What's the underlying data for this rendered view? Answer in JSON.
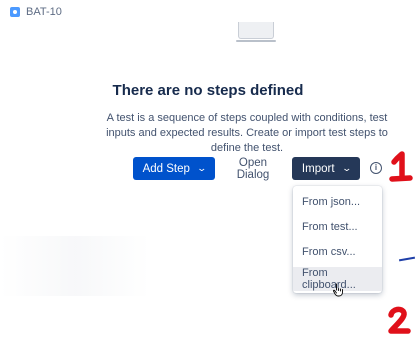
{
  "issue": {
    "key": "BAT-10",
    "icon": "issue-type-icon"
  },
  "empty_state": {
    "title": "There are no steps defined",
    "description": "A test is a sequence of steps coupled with conditions, test inputs and expected results. Create or import test steps to define the test."
  },
  "actions": {
    "add_step": "Add Step",
    "open_dialog": "Open Dialog",
    "import": "Import",
    "info_icon": "info-icon"
  },
  "import_menu": {
    "items": [
      "From json...",
      "From test...",
      "From csv...",
      "From clipboard..."
    ],
    "hovered_index": 3
  },
  "annotations": {
    "mark_1": "1",
    "mark_2": "2"
  },
  "colors": {
    "primary": "#0052cc",
    "import_button": "#253858",
    "annotation_red": "#e0101a",
    "annotation_blue": "#1e3fa8"
  }
}
